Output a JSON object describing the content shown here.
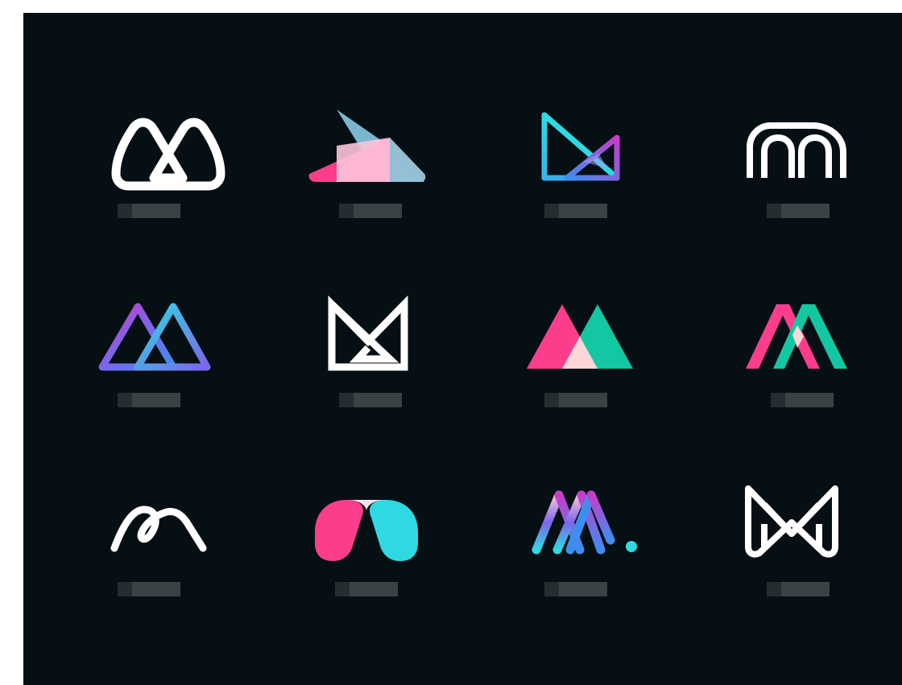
{
  "board": {
    "background": "#060f14",
    "page_background": "#ffffff"
  },
  "colors": {
    "white": "#ffffff",
    "pink": "#fc3d8b",
    "light_pink": "#fdc4da",
    "steel_blue": "#7ab7cf",
    "cyan": "#2fd9e2",
    "teal": "#12c7a1",
    "blue": "#3e8ef0",
    "violet": "#7b66ea",
    "magenta": "#c73cc8",
    "label_grey": "#2b3236",
    "label_grey_light": "#3a4246"
  },
  "logos": [
    {
      "icon": "m-loop-outline-icon"
    },
    {
      "icon": "m-overlapping-triangles-icon"
    },
    {
      "icon": "m-bowtie-gradient-icon"
    },
    {
      "icon": "m-arches-icon"
    },
    {
      "icon": "m-twin-peaks-gradient-icon"
    },
    {
      "icon": "m-envelope-icon"
    },
    {
      "icon": "m-mountain-overlap-icon"
    },
    {
      "icon": "m-ribbon-peaks-icon"
    },
    {
      "icon": "m-hook-curve-icon"
    },
    {
      "icon": "m-blob-pair-icon"
    },
    {
      "icon": "m-striped-stroke-dot-icon"
    },
    {
      "icon": "m-monogram-outline-icon"
    }
  ]
}
